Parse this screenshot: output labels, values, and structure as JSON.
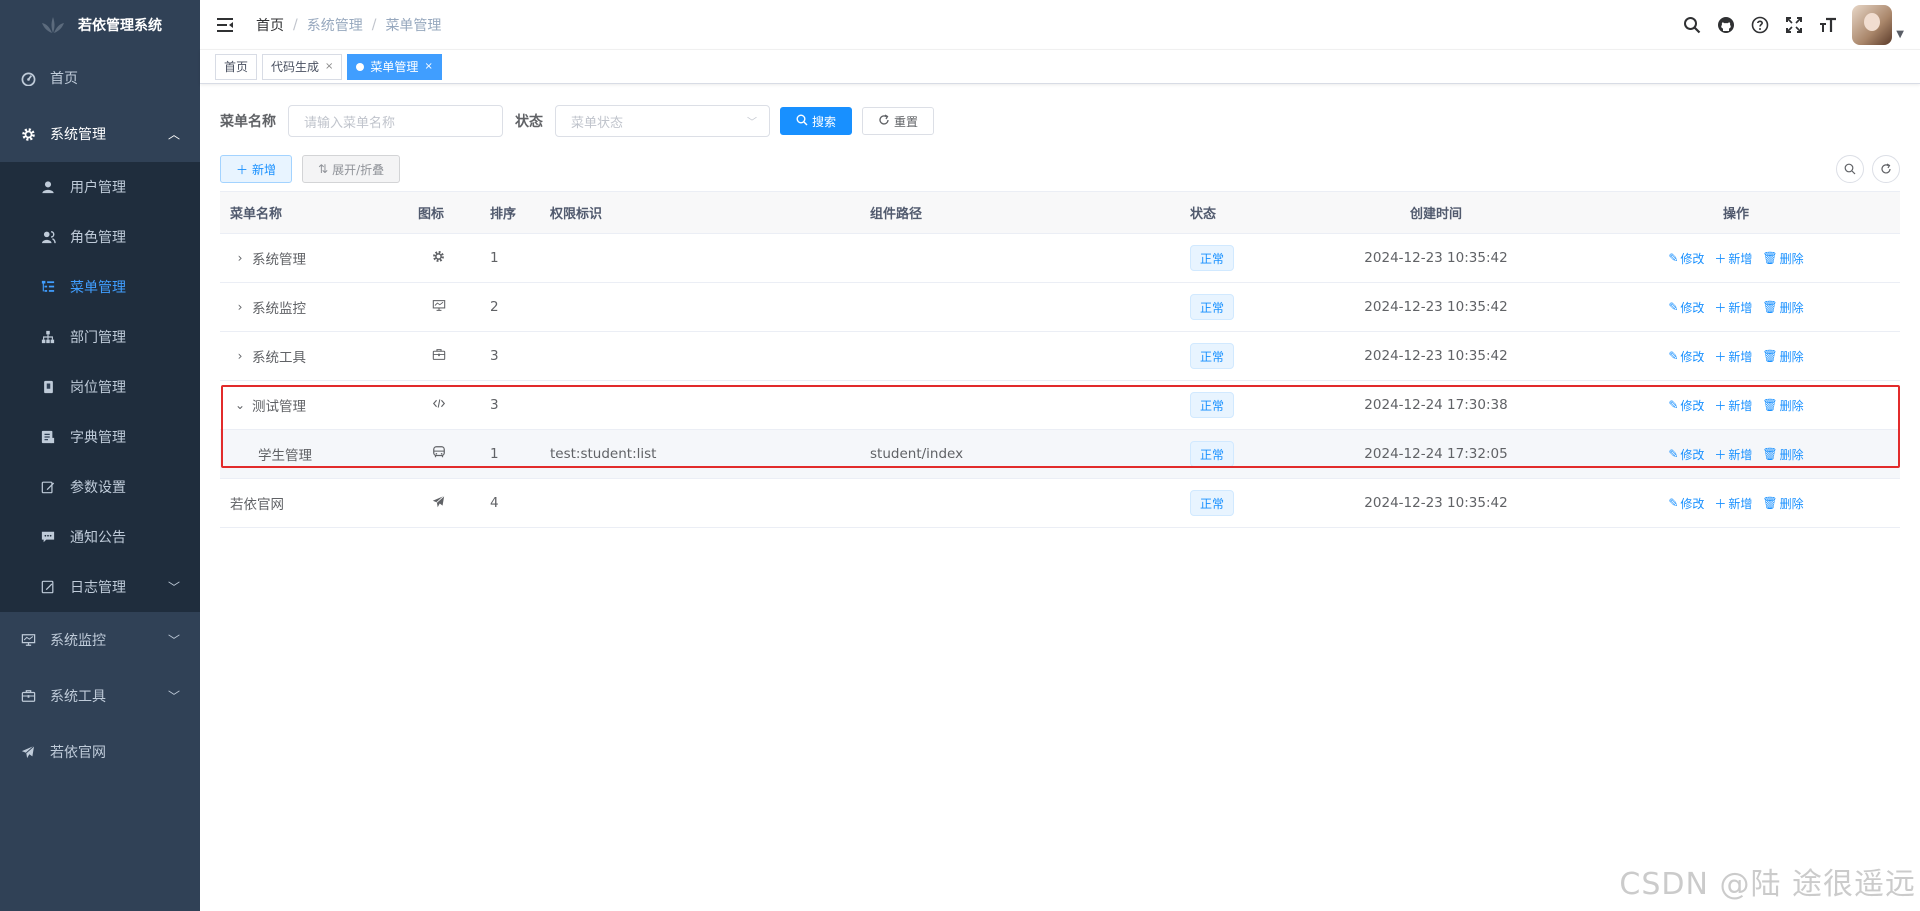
{
  "app": {
    "title": "若依管理系统"
  },
  "sidebar": {
    "items": [
      {
        "label": "首页",
        "icon": "dashboard-icon"
      },
      {
        "label": "系统管理",
        "icon": "gear-icon",
        "open": true,
        "children": [
          {
            "label": "用户管理",
            "icon": "user-icon"
          },
          {
            "label": "角色管理",
            "icon": "peoples-icon"
          },
          {
            "label": "菜单管理",
            "icon": "tree-table-icon",
            "active": true
          },
          {
            "label": "部门管理",
            "icon": "tree-icon"
          },
          {
            "label": "岗位管理",
            "icon": "post-icon"
          },
          {
            "label": "字典管理",
            "icon": "dict-icon"
          },
          {
            "label": "参数设置",
            "icon": "edit-icon"
          },
          {
            "label": "通知公告",
            "icon": "message-icon"
          },
          {
            "label": "日志管理",
            "icon": "log-icon"
          }
        ]
      },
      {
        "label": "系统监控",
        "icon": "monitor-icon"
      },
      {
        "label": "系统工具",
        "icon": "tool-icon"
      },
      {
        "label": "若依官网",
        "icon": "guide-icon"
      }
    ]
  },
  "breadcrumb": [
    "首页",
    "系统管理",
    "菜单管理"
  ],
  "tags": [
    {
      "label": "首页"
    },
    {
      "label": "代码生成",
      "close": "×"
    },
    {
      "label": "菜单管理",
      "close": "×",
      "active": true
    }
  ],
  "search": {
    "name_label": "菜单名称",
    "name_placeholder": "请输入菜单名称",
    "status_label": "状态",
    "status_placeholder": "菜单状态",
    "search_button": "搜索",
    "reset_button": "重置"
  },
  "toolbar": {
    "add_button": "新增",
    "expand_button": "展开/折叠"
  },
  "table": {
    "headers": {
      "name": "菜单名称",
      "icon": "图标",
      "order": "排序",
      "perm": "权限标识",
      "component": "组件路径",
      "status": "状态",
      "created": "创建时间",
      "ops": "操作"
    },
    "ops": {
      "edit": "修改",
      "add": "新增",
      "delete": "删除"
    },
    "rows": [
      {
        "name": "系统管理",
        "icon": "gear-icon",
        "order": "1",
        "perm": "",
        "component": "",
        "status": "正常",
        "created": "2024-12-23 10:35:42",
        "expand": "collapsed"
      },
      {
        "name": "系统监控",
        "icon": "monitor-icon",
        "order": "2",
        "perm": "",
        "component": "",
        "status": "正常",
        "created": "2024-12-23 10:35:42",
        "expand": "collapsed"
      },
      {
        "name": "系统工具",
        "icon": "tool-icon",
        "order": "3",
        "perm": "",
        "component": "",
        "status": "正常",
        "created": "2024-12-23 10:35:42",
        "expand": "collapsed"
      },
      {
        "name": "测试管理",
        "icon": "code-icon",
        "order": "3",
        "perm": "",
        "component": "",
        "status": "正常",
        "created": "2024-12-24 17:30:38",
        "expand": "expanded"
      },
      {
        "name": "学生管理",
        "icon": "bus-icon",
        "order": "1",
        "perm": "test:student:list",
        "component": "student/index",
        "status": "正常",
        "created": "2024-12-24 17:32:05",
        "expand": "child"
      },
      {
        "name": "若依官网",
        "icon": "guide-icon",
        "order": "4",
        "perm": "",
        "component": "",
        "status": "正常",
        "created": "2024-12-23 10:35:42",
        "expand": "none"
      }
    ]
  },
  "watermark": "CSDN @陆 途很遥远",
  "colors": {
    "sidebar_bg": "#304156",
    "submenu_bg": "#1f2d3d",
    "primary": "#1890ff",
    "highlight_border": "#e22b2b"
  }
}
